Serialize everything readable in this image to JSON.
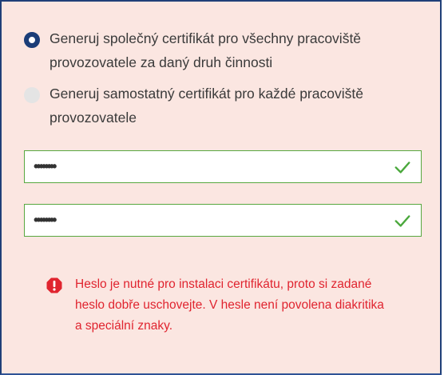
{
  "options": {
    "shared": {
      "label": "Generuj společný certifikát pro všechny pracoviště provozovatele za daný druh činnosti",
      "selected": true
    },
    "separate": {
      "label": "Generuj samostatný certifikát pro každé pracoviště provozovatele",
      "selected": false
    }
  },
  "password": {
    "value": "••••••••",
    "valid": true
  },
  "password_confirm": {
    "value": "••••••••",
    "valid": true
  },
  "alert": {
    "icon": "exclamation-octagon-icon",
    "text": "Heslo je nutné pro instalaci certifikátu, proto si zadané heslo dobře uschovejte. V hesle není povolena diakritika a speciální znaky."
  },
  "colors": {
    "panel_bg": "#fbe6e1",
    "radio_selected": "#1b3d78",
    "valid_border": "#58a83f",
    "valid_check": "#4aa83c",
    "alert_text": "#e0242f"
  }
}
